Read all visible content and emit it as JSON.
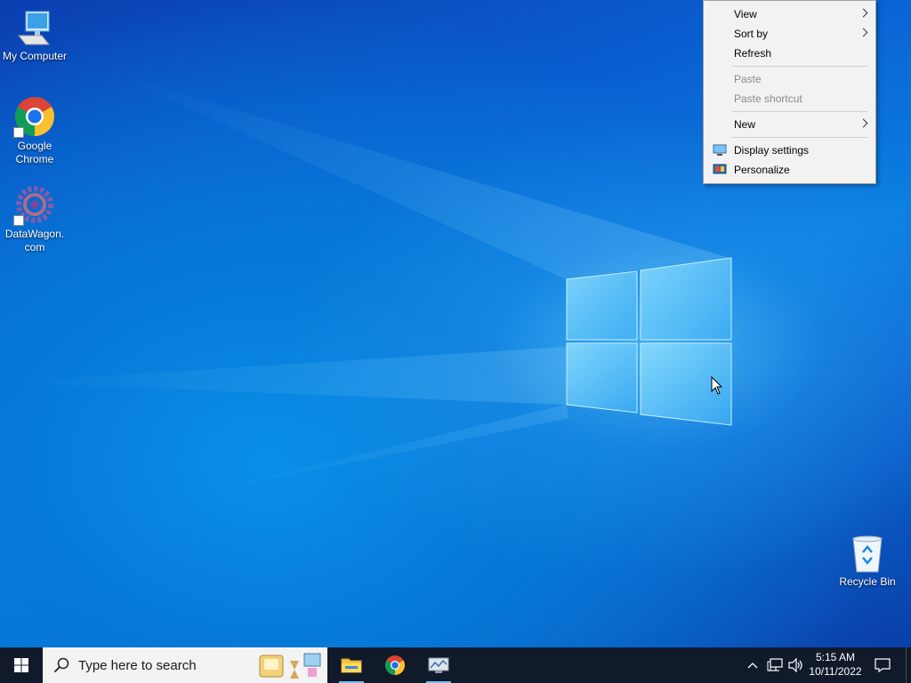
{
  "desktop": {
    "icons": [
      {
        "label": "My Computer",
        "icon": "computer-icon"
      },
      {
        "label": "Google Chrome",
        "icon": "chrome-icon"
      },
      {
        "label": "DataWagon.com",
        "icon": "datawagon-icon"
      },
      {
        "label": "Recycle Bin",
        "icon": "recycle-bin-icon"
      }
    ],
    "wallpaper": "windows-10-logo",
    "colors": {
      "accent": "#0a7fe0",
      "taskbar": "#101a2a"
    }
  },
  "context_menu": {
    "items": [
      {
        "label": "View",
        "submenu": true,
        "disabled": false
      },
      {
        "label": "Sort by",
        "submenu": true,
        "disabled": false
      },
      {
        "label": "Refresh",
        "submenu": false,
        "disabled": false
      },
      {
        "label": "Paste",
        "submenu": false,
        "disabled": true
      },
      {
        "label": "Paste shortcut",
        "submenu": false,
        "disabled": true
      },
      {
        "label": "New",
        "submenu": true,
        "disabled": false
      },
      {
        "label": "Display settings",
        "submenu": false,
        "disabled": false,
        "icon": "display-icon"
      },
      {
        "label": "Personalize",
        "submenu": false,
        "disabled": false,
        "icon": "personalize-icon"
      }
    ]
  },
  "taskbar": {
    "search_placeholder": "Type here to search",
    "pinned": [
      {
        "name": "File Explorer",
        "icon": "folder-icon",
        "active": true
      },
      {
        "name": "Google Chrome",
        "icon": "chrome-icon",
        "active": false
      },
      {
        "name": "Server Manager",
        "icon": "server-manager-icon",
        "active": true
      }
    ],
    "tray": {
      "time": "5:15 AM",
      "date": "10/11/2022"
    }
  }
}
